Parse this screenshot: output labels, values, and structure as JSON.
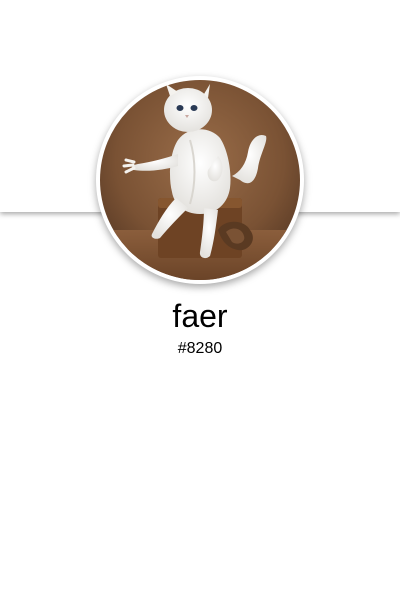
{
  "profile": {
    "username": "faer",
    "discriminator": "#8280",
    "avatar_icon": "avatar-white-cat-photo"
  },
  "colors": {
    "background": "#ffffff",
    "banner": "#ffffff",
    "avatar_ring": "#ffffff",
    "text": "#000000",
    "photo_background": "#7a5234"
  }
}
